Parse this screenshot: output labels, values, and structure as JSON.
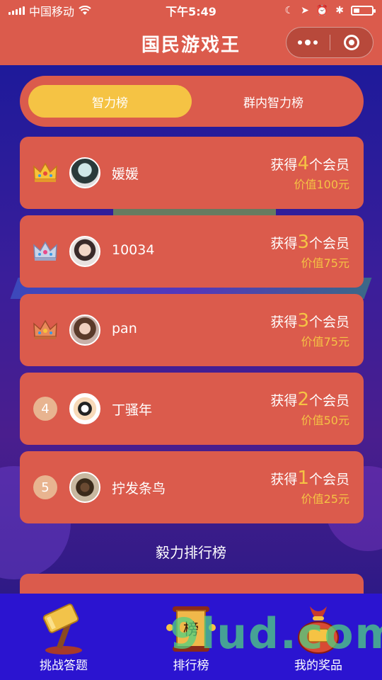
{
  "status_bar": {
    "carrier": "中国移动",
    "time": "下午5:49"
  },
  "nav": {
    "title": "国民游戏王"
  },
  "tabs": [
    {
      "label": "智力榜",
      "active": true
    },
    {
      "label": "群内智力榜",
      "active": false
    }
  ],
  "ranking": [
    {
      "rank": "1",
      "name": "媛媛",
      "prize_prefix": "获得",
      "count": "4",
      "prize_suffix": "个会员",
      "value": "价值100元",
      "badge": "gold-crown-icon"
    },
    {
      "rank": "2",
      "name": "10034",
      "prize_prefix": "获得",
      "count": "3",
      "prize_suffix": "个会员",
      "value": "价值75元",
      "badge": "silver-crown-icon"
    },
    {
      "rank": "3",
      "name": "pan",
      "prize_prefix": "获得",
      "count": "3",
      "prize_suffix": "个会员",
      "value": "价值75元",
      "badge": "bronze-crown-icon"
    },
    {
      "rank": "4",
      "name": "丁骚年",
      "prize_prefix": "获得",
      "count": "2",
      "prize_suffix": "个会员",
      "value": "价值50元",
      "badge": "rank-number"
    },
    {
      "rank": "5",
      "name": "拧发条鸟",
      "prize_prefix": "获得",
      "count": "1",
      "prize_suffix": "个会员",
      "value": "价值25元",
      "badge": "rank-number"
    }
  ],
  "section_title": "毅力排行榜",
  "tabbar": [
    {
      "label": "挑战答题",
      "icon": "hammer-icon"
    },
    {
      "label": "排行榜",
      "icon": "scroll-icon"
    },
    {
      "label": "我的奖品",
      "icon": "prize-bag-icon"
    }
  ],
  "watermark": "9lud.com",
  "colors": {
    "primary": "#db5b4c",
    "accent": "#f5c344",
    "background": "#2a1a8a",
    "tabbar": "#2b14d0"
  }
}
